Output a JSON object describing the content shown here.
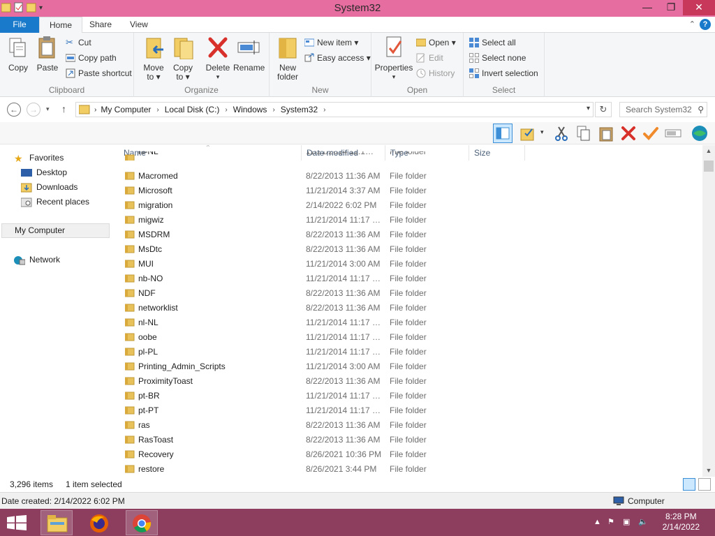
{
  "window": {
    "title": "System32"
  },
  "window_buttons": {
    "minimize": "—",
    "restore": "❐",
    "close": "✕"
  },
  "tabs": {
    "file": "File",
    "home": "Home",
    "share": "Share",
    "view": "View"
  },
  "help": "?",
  "ribbon": {
    "clipboard": {
      "label": "Clipboard",
      "copy": "Copy",
      "paste": "Paste",
      "cut": "Cut",
      "copy_path": "Copy path",
      "paste_shortcut": "Paste shortcut"
    },
    "organize": {
      "label": "Organize",
      "move_to": "Move",
      "move_to_2": "to ▾",
      "copy_to": "Copy",
      "copy_to_2": "to ▾",
      "delete": "Delete",
      "delete_arrow": "▾",
      "rename": "Rename"
    },
    "new": {
      "label": "New",
      "new_folder": "New",
      "new_folder_2": "folder",
      "new_item": "New item ▾",
      "easy_access": "Easy access ▾"
    },
    "open": {
      "label": "Open",
      "properties": "Properties",
      "properties_arrow": "▾",
      "open": "Open ▾",
      "edit": "Edit",
      "history": "History"
    },
    "select": {
      "label": "Select",
      "select_all": "Select all",
      "select_none": "Select none",
      "invert": "Invert selection"
    }
  },
  "address": {
    "crumbs": [
      "My Computer",
      "Local Disk (C:)",
      "Windows",
      "System32"
    ],
    "search_placeholder": "Search System32"
  },
  "nav": {
    "favorites": "Favorites",
    "desktop": "Desktop",
    "downloads": "Downloads",
    "recent": "Recent places",
    "computer": "My Computer",
    "network": "Network"
  },
  "columns": {
    "name": "Name",
    "date": "Date modified",
    "type": "Type",
    "size": "Size"
  },
  "rows": [
    {
      "name": "nl-NL",
      "date": "11/21/2014 11:1…",
      "type": "File folder"
    },
    {
      "name": "Macromed",
      "date": "8/22/2013 11:36 AM",
      "type": "File folder"
    },
    {
      "name": "Microsoft",
      "date": "11/21/2014 3:37 AM",
      "type": "File folder"
    },
    {
      "name": "migration",
      "date": "2/14/2022 6:02 PM",
      "type": "File folder"
    },
    {
      "name": "migwiz",
      "date": "11/21/2014 11:17 …",
      "type": "File folder"
    },
    {
      "name": "MSDRM",
      "date": "8/22/2013 11:36 AM",
      "type": "File folder"
    },
    {
      "name": "MsDtc",
      "date": "8/22/2013 11:36 AM",
      "type": "File folder"
    },
    {
      "name": "MUI",
      "date": "11/21/2014 3:00 AM",
      "type": "File folder"
    },
    {
      "name": "nb-NO",
      "date": "11/21/2014 11:17 …",
      "type": "File folder"
    },
    {
      "name": "NDF",
      "date": "8/22/2013 11:36 AM",
      "type": "File folder"
    },
    {
      "name": "networklist",
      "date": "8/22/2013 11:36 AM",
      "type": "File folder"
    },
    {
      "name": "nl-NL",
      "date": "11/21/2014 11:17 …",
      "type": "File folder"
    },
    {
      "name": "oobe",
      "date": "11/21/2014 11:17 …",
      "type": "File folder"
    },
    {
      "name": "pl-PL",
      "date": "11/21/2014 11:17 …",
      "type": "File folder"
    },
    {
      "name": "Printing_Admin_Scripts",
      "date": "11/21/2014 3:00 AM",
      "type": "File folder"
    },
    {
      "name": "ProximityToast",
      "date": "8/22/2013 11:36 AM",
      "type": "File folder"
    },
    {
      "name": "pt-BR",
      "date": "11/21/2014 11:17 …",
      "type": "File folder"
    },
    {
      "name": "pt-PT",
      "date": "11/21/2014 11:17 …",
      "type": "File folder"
    },
    {
      "name": "ras",
      "date": "8/22/2013 11:36 AM",
      "type": "File folder"
    },
    {
      "name": "RasToast",
      "date": "8/22/2013 11:36 AM",
      "type": "File folder"
    },
    {
      "name": "Recovery",
      "date": "8/26/2021 10:36 PM",
      "type": "File folder"
    },
    {
      "name": "restore",
      "date": "8/26/2021 3:44 PM",
      "type": "File folder"
    }
  ],
  "status": {
    "items": "3,296 items",
    "selected": "1 item selected"
  },
  "info": {
    "date_created": "Date created: 2/14/2022 6:02 PM",
    "location": "Computer"
  },
  "taskbar": {
    "time": "8:28 PM",
    "date": "2/14/2022"
  },
  "colors": {
    "titlebar": "#e56da0",
    "file_tab": "#1979ca",
    "taskbar": "#8d3e5f",
    "folder": "#e8c15a"
  }
}
